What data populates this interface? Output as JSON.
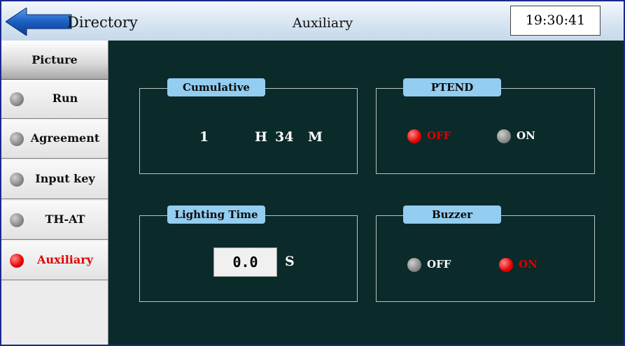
{
  "header": {
    "back_label": "Directory",
    "title": "Auxiliary",
    "clock": "19:30:41"
  },
  "sidebar": {
    "picture_label": "Picture",
    "items": [
      {
        "label": "Run",
        "active": false
      },
      {
        "label": "Agreement",
        "active": false
      },
      {
        "label": "Input key",
        "active": false
      },
      {
        "label": "TH-AT",
        "active": false
      },
      {
        "label": "Auxiliary",
        "active": true
      }
    ]
  },
  "cumulative": {
    "title": "Cumulative",
    "hours": "1",
    "hours_unit": "H",
    "minutes": "34",
    "minutes_unit": "M"
  },
  "ptend": {
    "title": "PTEND",
    "off_label": "OFF",
    "on_label": "ON",
    "selected": "OFF"
  },
  "lighting": {
    "title": "Lighting Time",
    "value": "0.0",
    "unit": "S"
  },
  "buzzer": {
    "title": "Buzzer",
    "off_label": "OFF",
    "on_label": "ON",
    "selected": "ON"
  },
  "colors": {
    "background": "#0b2a2a",
    "panel_tag": "#93cdf0",
    "indicator_on": "#e80000",
    "indicator_off": "#8a8a8a"
  }
}
